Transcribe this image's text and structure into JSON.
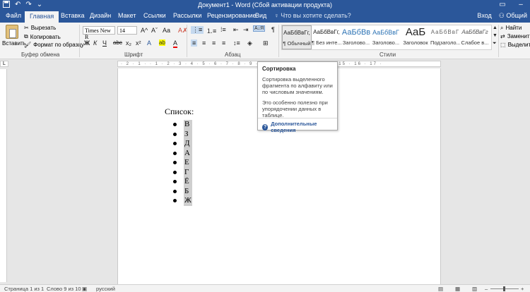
{
  "titlebar": {
    "title": "Документ1 - Word (Сбой активации продукта)",
    "save_icon": "save-icon",
    "undo_icon": "undo-icon",
    "redo_icon": "redo-icon",
    "min": "–",
    "max": "□",
    "close": "✕",
    "ribbon_opts": "▭"
  },
  "tabs": [
    "Файл",
    "Главная",
    "Вставка",
    "Дизайн",
    "Макет",
    "Ссылки",
    "Рассылки",
    "Рецензирование",
    "Вид"
  ],
  "tellme": "Что вы хотите сделать?",
  "signin": "Вход",
  "share": "Общий",
  "clipboard": {
    "paste": "Вставить",
    "cut": "Вырезать",
    "copy": "Копировать",
    "format_painter": "Формат по образцу",
    "label": "Буфер обмена"
  },
  "font": {
    "name": "Times New R",
    "size": "14",
    "label": "Шрифт",
    "bold": "Ж",
    "italic": "К",
    "underline": "Ч",
    "strike": "abc",
    "sub": "x₂",
    "sup": "x²",
    "grow": "A^",
    "shrink": "Aˇ",
    "case": "Aa",
    "clear": "A✗",
    "highlight": "ab",
    "color": "A"
  },
  "paragraph": {
    "label": "Абзац",
    "sort": "А↓Я",
    "pilcrow": "¶"
  },
  "styles": {
    "label": "Стили",
    "items": [
      {
        "preview": "АаБбВвГг,",
        "name": "¶ Обычный"
      },
      {
        "preview": "АаБбВвГг,",
        "name": "¶ Без инте..."
      },
      {
        "preview": "АаБбВв",
        "name": "Заголово..."
      },
      {
        "preview": "АаБбВвГ",
        "name": "Заголово..."
      },
      {
        "preview": "АаБ",
        "name": "Заголовок"
      },
      {
        "preview": "АаБбВвГ",
        "name": "Подзаголо..."
      },
      {
        "preview": "АаБбВвГг",
        "name": "Слабое в..."
      }
    ]
  },
  "editing": {
    "find": "Найти",
    "replace": "Заменить",
    "select": "Выделить"
  },
  "ruler": {
    "marks": "· 2 · 1 · · 1 · 2 · 3 · 4 · 5 · 6 · 7 · 8 · 9 · 10 · 11 · 12 · 13 · 14 · 15 · 16 · 17 ·"
  },
  "document": {
    "title": "Список:",
    "items": [
      "В",
      "З",
      "Д",
      "А",
      "Е",
      "Г",
      "Ё",
      "Б",
      "Ж"
    ]
  },
  "tooltip": {
    "title": "Сортировка",
    "description": "Сортировка выделенного фрагмента по алфавиту или по числовым значениям.",
    "note": "Это особенно полезно при упорядочении данных в таблице.",
    "link": "Дополнительные сведения"
  },
  "status": {
    "page": "Страница 1 из 1",
    "words": "Слово 9 из 10",
    "language": "русский"
  }
}
